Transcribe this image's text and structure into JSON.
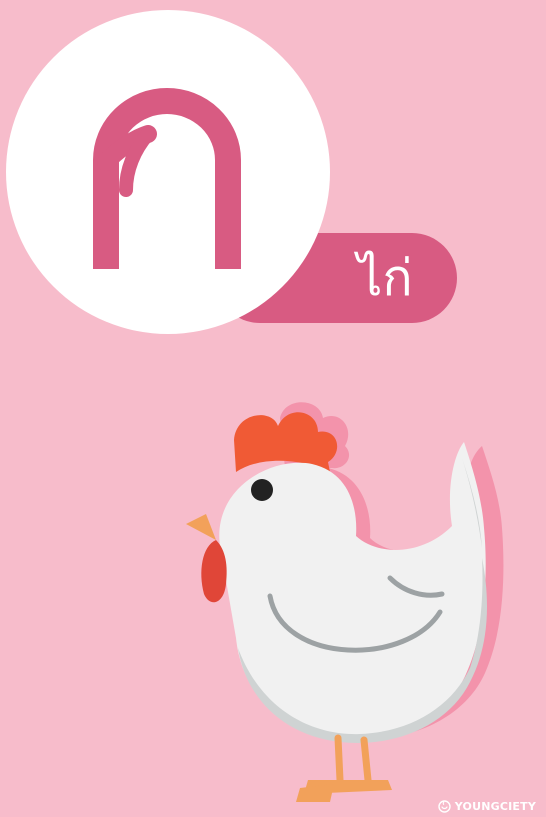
{
  "colors": {
    "background": "#f7bccb",
    "accent": "#d85b82",
    "circle": "#ffffff",
    "comb": "#f05a35",
    "beak": "#f2a15a",
    "body": "#f1f1f1",
    "shadow": "#f393ab"
  },
  "card": {
    "letter": "ก",
    "word": "ไก่",
    "illustration": "chicken-illustration"
  },
  "brand": {
    "name": "YOUNGCIETY",
    "icon": "youngciety-logo-icon"
  }
}
